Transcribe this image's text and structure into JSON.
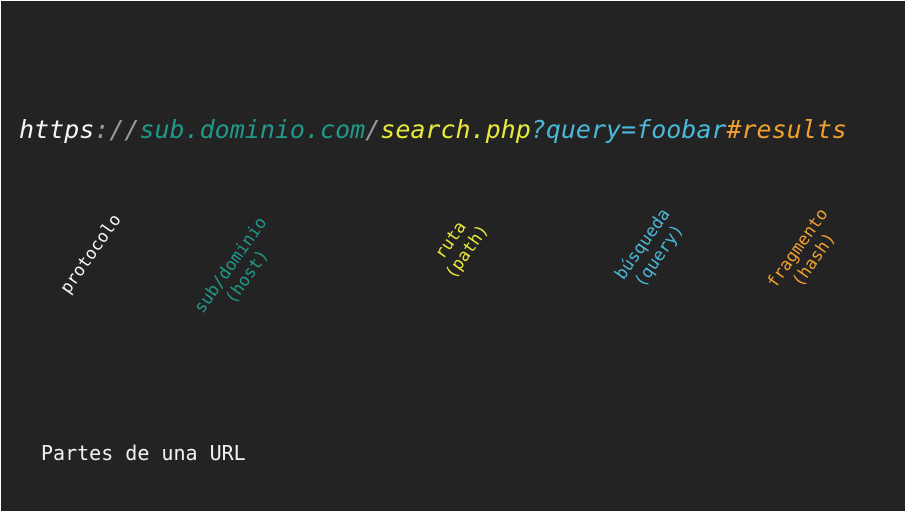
{
  "url": {
    "protocol": "https",
    "separator": "://",
    "host": "sub.dominio.com",
    "slash": "/",
    "path": "search.php",
    "query": "?query=foobar",
    "hash": "#results"
  },
  "labels": {
    "protocol": {
      "line1": "protocolo",
      "line2": ""
    },
    "host": {
      "line1": "sub/dominio",
      "line2": "(host)"
    },
    "path": {
      "line1": "ruta",
      "line2": "(path)"
    },
    "query": {
      "line1": "búsqueda",
      "line2": "(query)"
    },
    "hash": {
      "line1": "fragmento",
      "line2": "(hash)"
    }
  },
  "caption": "Partes de una URL",
  "colors": {
    "background": "#232323",
    "protocol": "#f5f5f5",
    "separator": "#9a9a9a",
    "host": "#1f9a8a",
    "path": "#e8e83a",
    "query": "#4bb8d8",
    "hash": "#f0a030"
  }
}
